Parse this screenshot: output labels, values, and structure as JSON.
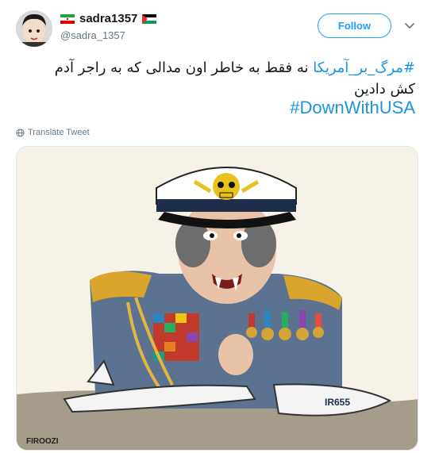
{
  "user": {
    "display_name": "sadra1357",
    "handle": "@sadra_1357"
  },
  "actions": {
    "follow_label": "Follow"
  },
  "tweet": {
    "hashtag_fa": "#مرگ_بر_آمریکا",
    "text_line1_rest": "نه فقط به خاطر اون مدالی که به راجر آدم",
    "text_line2": "کش دادین",
    "hashtag_en": "#DownWithUSA"
  },
  "translate_label": "Translate Tweet",
  "media": {
    "alt": "Cartoon of a general with skull cap crushing an airplane",
    "plane_marking": "IR655",
    "signature": "FIROOZI"
  },
  "colors": {
    "accent": "#1da1f2",
    "hashtag": "#1b95e0",
    "muted": "#657786"
  },
  "icons": {
    "flag_left": "iran-flag-icon",
    "flag_right": "palestine-flag-icon",
    "chevron": "chevron-down-icon",
    "translate": "globe-icon"
  }
}
